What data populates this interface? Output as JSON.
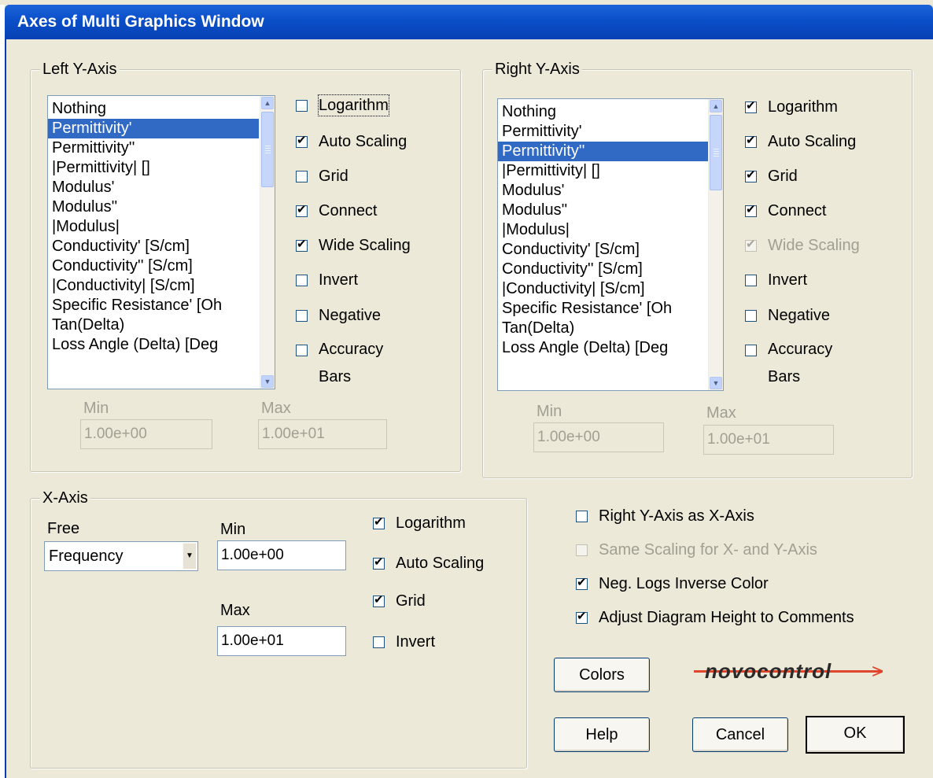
{
  "window": {
    "title": "Axes of Multi Graphics Window"
  },
  "list_items": [
    "Nothing",
    "Permittivity'",
    "Permittivity''",
    "|Permittivity| []",
    "Modulus'",
    "Modulus''",
    "|Modulus|",
    "Conductivity' [S/cm]",
    "Conductivity'' [S/cm]",
    "|Conductivity| [S/cm]",
    "Specific Resistance' [Oh",
    "Tan(Delta)",
    "Loss Angle (Delta) [Deg"
  ],
  "left_y": {
    "title": "Left Y-Axis",
    "selected": "Permittivity'",
    "options": {
      "logarithm": "Logarithm",
      "auto_scaling": "Auto Scaling",
      "grid": "Grid",
      "connect": "Connect",
      "wide_scaling": "Wide Scaling",
      "invert": "Invert",
      "negative": "Negative",
      "accuracy": "Accuracy",
      "bars": "Bars"
    },
    "checked": {
      "logarithm": false,
      "auto_scaling": true,
      "grid": false,
      "connect": true,
      "wide_scaling": true,
      "invert": false,
      "negative": false,
      "accuracy_bars": false
    },
    "min_label": "Min",
    "max_label": "Max",
    "min_value": "1.00e+00",
    "max_value": "1.00e+01"
  },
  "right_y": {
    "title": "Right Y-Axis",
    "selected": "Permittivity''",
    "options": {
      "logarithm": "Logarithm",
      "auto_scaling": "Auto Scaling",
      "grid": "Grid",
      "connect": "Connect",
      "wide_scaling": "Wide Scaling",
      "invert": "Invert",
      "negative": "Negative",
      "accuracy": "Accuracy",
      "bars": "Bars"
    },
    "checked": {
      "logarithm": true,
      "auto_scaling": true,
      "grid": true,
      "connect": true,
      "wide_scaling": true,
      "invert": false,
      "negative": false,
      "accuracy_bars": false
    },
    "min_label": "Min",
    "max_label": "Max",
    "min_value": "1.00e+00",
    "max_value": "1.00e+01"
  },
  "x_axis": {
    "title": "X-Axis",
    "free_label": "Free",
    "free_value": "Frequency",
    "min_label": "Min",
    "max_label": "Max",
    "min_value": "1.00e+00",
    "max_value": "1.00e+01",
    "options": {
      "logarithm": "Logarithm",
      "auto_scaling": "Auto Scaling",
      "grid": "Grid",
      "invert": "Invert"
    },
    "checked": {
      "logarithm": true,
      "auto_scaling": true,
      "grid": true,
      "invert": false
    }
  },
  "global_options": {
    "right_as_x": "Right Y-Axis as X-Axis",
    "same_scaling": "Same Scaling for X- and Y-Axis",
    "neg_logs": "Neg. Logs Inverse Color",
    "adjust_height": "Adjust Diagram Height to Comments",
    "checked": {
      "right_as_x": false,
      "same_scaling": false,
      "neg_logs": true,
      "adjust_height": true
    }
  },
  "buttons": {
    "colors": "Colors",
    "help": "Help",
    "cancel": "Cancel",
    "ok": "OK"
  },
  "logo": {
    "text": "novocontrol"
  },
  "colors": {
    "selection": "#316ac5",
    "titlebar": "#0a4fc8",
    "dialog_bg": "#ece9d8",
    "logo_accent": "#e0452d"
  }
}
